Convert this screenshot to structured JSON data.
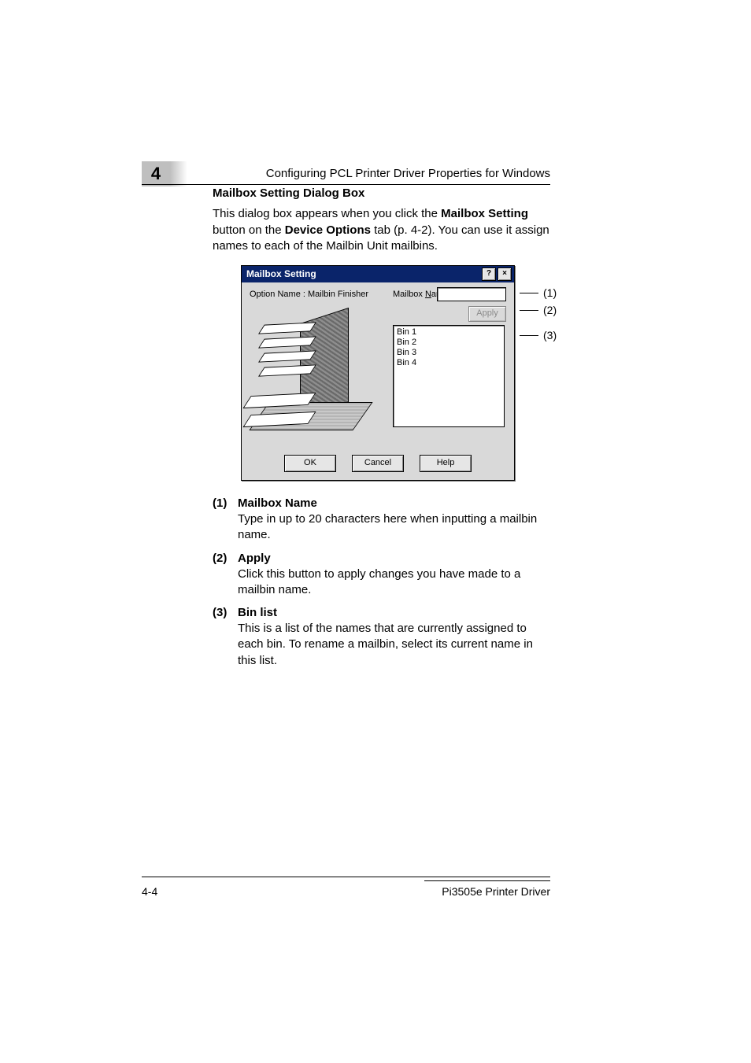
{
  "chapter_number": "4",
  "header_title": "Configuring PCL Printer Driver Properties for Windows",
  "section_heading": "Mailbox Setting Dialog Box",
  "intro_part1": "This dialog box appears when you click the ",
  "intro_bold1": "Mailbox Setting",
  "intro_part2": " button on the ",
  "intro_bold2": "Device Options",
  "intro_part3": " tab (p. 4-2). You can use it assign names to each of the Mailbin Unit mailbins.",
  "dialog": {
    "title": "Mailbox Setting",
    "help_btn": "?",
    "close_btn": "×",
    "option_name": "Option Name : Mailbin Finisher",
    "mailbox_name_label_pre": "Mailbox ",
    "mailbox_name_label_u": "N",
    "mailbox_name_label_post": "ame :",
    "apply_label": "Apply",
    "bins": [
      "Bin 1",
      "Bin 2",
      "Bin 3",
      "Bin 4"
    ],
    "ok": "OK",
    "cancel": "Cancel",
    "help": "Help"
  },
  "callouts": {
    "c1": "(1)",
    "c2": "(2)",
    "c3": "(3)"
  },
  "items": [
    {
      "num": "(1)",
      "title": "Mailbox Name",
      "desc": "Type in up to 20 characters here when inputting a mailbin name."
    },
    {
      "num": "(2)",
      "title": "Apply",
      "desc": "Click this button to apply changes you have made to a mailbin name."
    },
    {
      "num": "(3)",
      "title": "Bin list",
      "desc": "This is a list of the names that are currently assigned to each bin. To rename a mailbin, select its current name in this list."
    }
  ],
  "footer_left": "4-4",
  "footer_right": "Pi3505e Printer Driver"
}
